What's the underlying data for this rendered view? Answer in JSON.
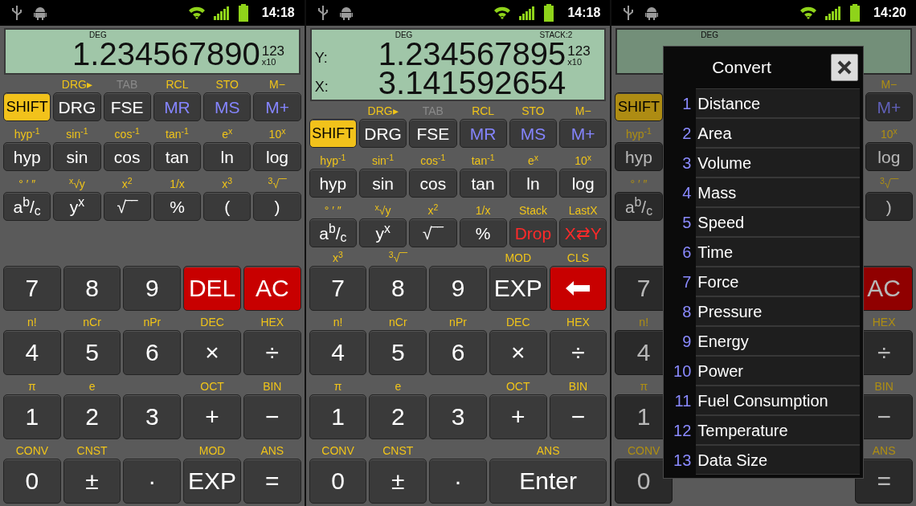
{
  "phones": [
    {
      "status_bar": {
        "time": "14:18"
      },
      "dimmed": false,
      "display": {
        "kind": "single",
        "mode": "DEG",
        "lines": [
          {
            "value": "1.234567890"
          }
        ],
        "exponent": {
          "power": "123",
          "base": "x10"
        }
      },
      "top_rows": [
        [
          {
            "label": "SHIFT",
            "kind": "shift"
          },
          {
            "label": "DRG",
            "kind": "normal",
            "shift": {
              "text": "DRG▸",
              "disabled": false
            }
          },
          {
            "label": "FSE",
            "kind": "normal",
            "shift": {
              "text": "TAB",
              "disabled": true
            }
          },
          {
            "label": "MR",
            "kind": "memory",
            "shift": {
              "text": "RCL",
              "disabled": false
            }
          },
          {
            "label": "MS",
            "kind": "memory",
            "shift": {
              "text": "STO",
              "disabled": false
            }
          },
          {
            "label": "M+",
            "kind": "memory",
            "shift": {
              "text": "M−",
              "disabled": false
            }
          }
        ],
        [
          {
            "label": "hyp",
            "kind": "normal",
            "shift": {
              "text": "hyp$^{-1}$",
              "disabled": false
            }
          },
          {
            "label": "sin",
            "kind": "normal",
            "shift": {
              "text": "sin$^{-1}$",
              "disabled": false
            }
          },
          {
            "label": "cos",
            "kind": "normal",
            "shift": {
              "text": "cos$^{-1}$",
              "disabled": false
            }
          },
          {
            "label": "tan",
            "kind": "normal",
            "shift": {
              "text": "tan$^{-1}$",
              "disabled": false
            }
          },
          {
            "label": "ln",
            "kind": "normal",
            "shift": {
              "text": "e$^{x}$",
              "disabled": false
            }
          },
          {
            "label": "log",
            "kind": "normal",
            "shift": {
              "text": "10$^{x}$",
              "disabled": false
            }
          }
        ],
        [
          {
            "label": "a$^{b}$/$_{c}$",
            "kind": "normal",
            "shift": {
              "text": "° ′ ″",
              "disabled": false
            }
          },
          {
            "label": "y$^{x}$",
            "kind": "normal",
            "shift": {
              "text": "$^{x}$√y",
              "disabled": false
            }
          },
          {
            "label": "√‾‾",
            "kind": "normal",
            "shift": {
              "text": "x$^{2}$",
              "disabled": false
            }
          },
          {
            "label": "%",
            "kind": "normal",
            "shift": {
              "text": "1/x",
              "disabled": false
            }
          },
          {
            "label": "(",
            "kind": "normal",
            "shift": {
              "text": "x$^{3}$",
              "disabled": false
            }
          },
          {
            "label": ")",
            "kind": "normal",
            "shift": {
              "text": "$^{3}$√‾‾",
              "disabled": false
            }
          }
        ]
      ],
      "bottom_rows": [
        [
          {
            "label": "7",
            "kind": "normal"
          },
          {
            "label": "8",
            "kind": "normal"
          },
          {
            "label": "9",
            "kind": "normal"
          },
          {
            "label": "DEL",
            "kind": "clear"
          },
          {
            "label": "AC",
            "kind": "clear"
          }
        ],
        [
          {
            "label": "4",
            "kind": "normal",
            "shift": {
              "text": "n!",
              "disabled": false
            }
          },
          {
            "label": "5",
            "kind": "normal",
            "shift": {
              "text": "nCr",
              "disabled": false
            }
          },
          {
            "label": "6",
            "kind": "normal",
            "shift": {
              "text": "nPr",
              "disabled": false
            }
          },
          {
            "label": "×",
            "kind": "normal",
            "shift": {
              "text": "DEC",
              "disabled": false
            }
          },
          {
            "label": "÷",
            "kind": "normal",
            "shift": {
              "text": "HEX",
              "disabled": false
            }
          }
        ],
        [
          {
            "label": "1",
            "kind": "normal",
            "shift": {
              "text": "π",
              "disabled": false
            }
          },
          {
            "label": "2",
            "kind": "normal",
            "shift": {
              "text": "e",
              "disabled": false
            }
          },
          {
            "label": "3",
            "kind": "normal"
          },
          {
            "label": "+",
            "kind": "normal",
            "shift": {
              "text": "OCT",
              "disabled": false
            }
          },
          {
            "label": "−",
            "kind": "normal",
            "shift": {
              "text": "BIN",
              "disabled": false
            }
          }
        ],
        [
          {
            "label": "0",
            "kind": "normal",
            "shift": {
              "text": "CONV",
              "disabled": false
            }
          },
          {
            "label": "±",
            "kind": "normal",
            "shift": {
              "text": "CNST",
              "disabled": false
            }
          },
          {
            "label": "·",
            "kind": "normal"
          },
          {
            "label": "EXP",
            "kind": "normal",
            "shift": {
              "text": "MOD",
              "disabled": false
            }
          },
          {
            "label": "=",
            "kind": "normal",
            "shift": {
              "text": "ANS",
              "disabled": false
            }
          }
        ]
      ]
    },
    {
      "status_bar": {
        "time": "14:18"
      },
      "dimmed": false,
      "display": {
        "kind": "double",
        "mode": "DEG",
        "stack": "STACK:2",
        "lines": [
          {
            "register": "Y:",
            "value": "1.234567895"
          },
          {
            "register": "X:",
            "value": "3.141592654"
          }
        ],
        "exponent": {
          "power": "123",
          "base": "x10"
        }
      },
      "top_rows": [
        [
          {
            "label": "SHIFT",
            "kind": "shift"
          },
          {
            "label": "DRG",
            "kind": "normal",
            "shift": {
              "text": "DRG▸",
              "disabled": false
            }
          },
          {
            "label": "FSE",
            "kind": "normal",
            "shift": {
              "text": "TAB",
              "disabled": true
            }
          },
          {
            "label": "MR",
            "kind": "memory",
            "shift": {
              "text": "RCL",
              "disabled": false
            }
          },
          {
            "label": "MS",
            "kind": "memory",
            "shift": {
              "text": "STO",
              "disabled": false
            }
          },
          {
            "label": "M+",
            "kind": "memory",
            "shift": {
              "text": "M−",
              "disabled": false
            }
          }
        ],
        [
          {
            "label": "hyp",
            "kind": "normal",
            "shift": {
              "text": "hyp$^{-1}$",
              "disabled": false
            }
          },
          {
            "label": "sin",
            "kind": "normal",
            "shift": {
              "text": "sin$^{-1}$",
              "disabled": false
            }
          },
          {
            "label": "cos",
            "kind": "normal",
            "shift": {
              "text": "cos$^{-1}$",
              "disabled": false
            }
          },
          {
            "label": "tan",
            "kind": "normal",
            "shift": {
              "text": "tan$^{-1}$",
              "disabled": false
            }
          },
          {
            "label": "ln",
            "kind": "normal",
            "shift": {
              "text": "e$^{x}$",
              "disabled": false
            }
          },
          {
            "label": "log",
            "kind": "normal",
            "shift": {
              "text": "10$^{x}$",
              "disabled": false
            }
          }
        ],
        [
          {
            "label": "a$^{b}$/$_{c}$",
            "kind": "normal",
            "shift": {
              "text": "° ′ ″",
              "disabled": false
            }
          },
          {
            "label": "y$^{x}$",
            "kind": "normal",
            "shift": {
              "text": "$^{x}$√y",
              "disabled": false
            }
          },
          {
            "label": "√‾‾",
            "kind": "normal",
            "shift": {
              "text": "x$^{2}$",
              "disabled": false
            }
          },
          {
            "label": "%",
            "kind": "normal",
            "shift": {
              "text": "1/x",
              "disabled": false
            }
          },
          {
            "label": "Drop",
            "kind": "stack",
            "shift": {
              "text": "Stack",
              "disabled": false
            }
          },
          {
            "label": "X⇄Y",
            "kind": "stack",
            "shift": {
              "text": "LastX",
              "disabled": false
            }
          }
        ]
      ],
      "bottom_rows": [
        [
          {
            "label": "7",
            "kind": "normal",
            "shift": {
              "text": "x$^{3}$",
              "disabled": false
            }
          },
          {
            "label": "8",
            "kind": "normal",
            "shift": {
              "text": "$^{3}$√‾‾",
              "disabled": false
            }
          },
          {
            "label": "9",
            "kind": "normal"
          },
          {
            "label": "EXP",
            "kind": "normal",
            "shift": {
              "text": "MOD",
              "disabled": false
            }
          },
          {
            "kind": "backspace",
            "shift": {
              "text": "CLS",
              "disabled": false
            }
          }
        ],
        [
          {
            "label": "4",
            "kind": "normal",
            "shift": {
              "text": "n!",
              "disabled": false
            }
          },
          {
            "label": "5",
            "kind": "normal",
            "shift": {
              "text": "nCr",
              "disabled": false
            }
          },
          {
            "label": "6",
            "kind": "normal",
            "shift": {
              "text": "nPr",
              "disabled": false
            }
          },
          {
            "label": "×",
            "kind": "normal",
            "shift": {
              "text": "DEC",
              "disabled": false
            }
          },
          {
            "label": "÷",
            "kind": "normal",
            "shift": {
              "text": "HEX",
              "disabled": false
            }
          }
        ],
        [
          {
            "label": "1",
            "kind": "normal",
            "shift": {
              "text": "π",
              "disabled": false
            }
          },
          {
            "label": "2",
            "kind": "normal",
            "shift": {
              "text": "e",
              "disabled": false
            }
          },
          {
            "label": "3",
            "kind": "normal"
          },
          {
            "label": "+",
            "kind": "normal",
            "shift": {
              "text": "OCT",
              "disabled": false
            }
          },
          {
            "label": "−",
            "kind": "normal",
            "shift": {
              "text": "BIN",
              "disabled": false
            }
          }
        ],
        [
          {
            "label": "0",
            "kind": "normal",
            "shift": {
              "text": "CONV",
              "disabled": false
            }
          },
          {
            "label": "±",
            "kind": "normal",
            "shift": {
              "text": "CNST",
              "disabled": false
            }
          },
          {
            "label": "·",
            "kind": "normal"
          },
          {
            "label": "Enter",
            "kind": "enter",
            "shift": {
              "text": "ANS",
              "disabled": false
            }
          }
        ]
      ]
    },
    {
      "status_bar": {
        "time": "14:20"
      },
      "dimmed": true,
      "display": {
        "kind": "single",
        "mode": "DEG"
      },
      "top_rows": [
        [
          {
            "label": "SHIFT",
            "kind": "shift"
          },
          null,
          null,
          null,
          null,
          {
            "label": "M+",
            "kind": "memory",
            "shift": {
              "text": "M−",
              "disabled": false
            }
          }
        ],
        [
          {
            "label": "hyp",
            "kind": "normal",
            "shift": {
              "text": "hyp$^{-1}$",
              "disabled": false
            }
          },
          null,
          null,
          null,
          null,
          {
            "label": "log",
            "kind": "normal",
            "shift": {
              "text": "10$^{x}$",
              "disabled": false
            }
          }
        ],
        [
          {
            "label": "a$^{b}$/$_{c}$",
            "kind": "normal",
            "shift": {
              "text": "° ′ ″",
              "disabled": false
            }
          },
          null,
          null,
          null,
          null,
          {
            "label": ")",
            "kind": "normal",
            "shift": {
              "text": "$^{3}$√‾‾",
              "disabled": false
            }
          }
        ]
      ],
      "bottom_rows": [
        [
          {
            "label": "7",
            "kind": "normal"
          },
          null,
          null,
          null,
          {
            "label": "AC",
            "kind": "clear"
          }
        ],
        [
          {
            "label": "4",
            "kind": "normal",
            "shift": {
              "text": "n!",
              "disabled": false
            }
          },
          null,
          null,
          null,
          {
            "label": "÷",
            "kind": "normal",
            "shift": {
              "text": "HEX",
              "disabled": false
            }
          }
        ],
        [
          {
            "label": "1",
            "kind": "normal",
            "shift": {
              "text": "π",
              "disabled": false
            }
          },
          null,
          null,
          null,
          {
            "label": "−",
            "kind": "normal",
            "shift": {
              "text": "BIN",
              "disabled": false
            }
          }
        ],
        [
          {
            "label": "0",
            "kind": "normal",
            "shift": {
              "text": "CONV",
              "disabled": false
            }
          },
          null,
          null,
          null,
          {
            "label": "=",
            "kind": "normal",
            "shift": {
              "text": "ANS",
              "disabled": false
            }
          }
        ]
      ],
      "dialog": {
        "title": "Convert",
        "items": [
          {
            "number": "1",
            "label": "Distance"
          },
          {
            "number": "2",
            "label": "Area"
          },
          {
            "number": "3",
            "label": "Volume"
          },
          {
            "number": "4",
            "label": "Mass"
          },
          {
            "number": "5",
            "label": "Speed"
          },
          {
            "number": "6",
            "label": "Time"
          },
          {
            "number": "7",
            "label": "Force"
          },
          {
            "number": "8",
            "label": "Pressure"
          },
          {
            "number": "9",
            "label": "Energy"
          },
          {
            "number": "10",
            "label": "Power"
          },
          {
            "number": "11",
            "label": "Fuel Consumption"
          },
          {
            "number": "12",
            "label": "Temperature"
          },
          {
            "number": "13",
            "label": "Data Size"
          }
        ]
      }
    }
  ]
}
